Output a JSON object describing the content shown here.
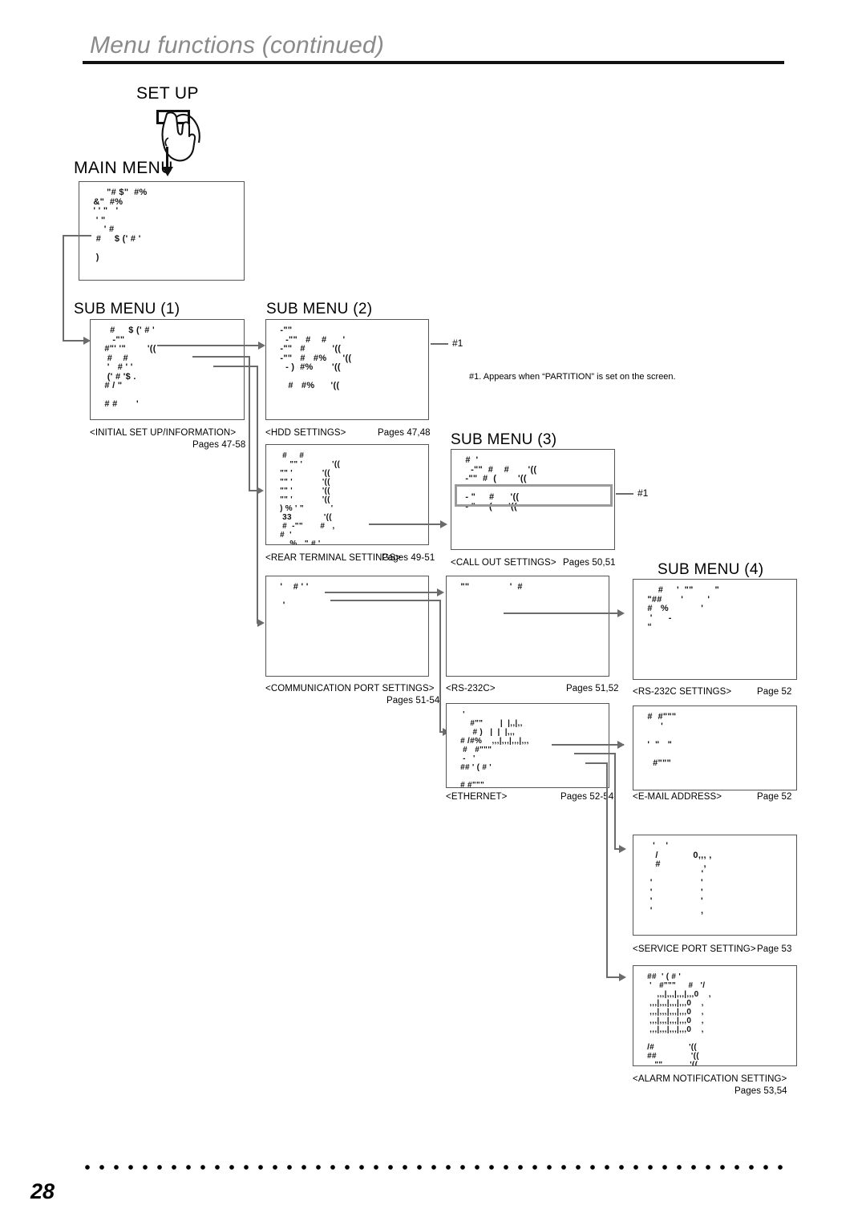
{
  "header": {
    "title": "Menu functions (continued)"
  },
  "setup": {
    "button_label": "SET UP",
    "main_menu_label": "MAIN MENU"
  },
  "sub_menu_headings": {
    "s1": "SUB MENU  (1)",
    "s2": "SUB MENU  (2)",
    "s3": "SUB MENU  (3)",
    "s4": "SUB MENU  (4)"
  },
  "footnote": {
    "marker_1": "#1",
    "marker_2": "#1",
    "text": "#1. Appears when “PARTITION” is set on the screen."
  },
  "boxes": [
    {
      "id": "main-menu",
      "caption": "",
      "pages": "",
      "screen": "      \"# $\"  #%\n &\"  #%\n ' ' \"   '\n  ' \"\n     ' #\n  #     $ (' # '\n\n  )\n\n\n  “"
    },
    {
      "id": "initial-setup-information",
      "caption": "<INITIAL SET UP/INFORMATION>",
      "pages": "Pages 47-58",
      "screen": "   #     $ (' # '\n    -\"\"\n #\"' '\"        '((\n  #    #\n  '   # ' '\n  (' # '$ .\n # / \"\n\n # #       '"
    },
    {
      "id": "hdd-settings",
      "caption": "<HDD SETTINGS>",
      "pages": "Pages 47,48",
      "screen": " -\"\"\n   -\"\"   #    #      '\n -\"\"   #          '((\n -\"\"   #   #%      '((\n   - )  #%       '((\n\n    #   #%      '(("
    },
    {
      "id": "rear-terminal-settings",
      "caption": "<REAR TERMINAL SETTINGS>",
      "pages": "Pages 49-51",
      "screen": "  #     #\n     \"\" '            '((\n \"\" '            '((\n \"\" '            '((\n \"\" '            '((\n \"\" '            '((\n ) % ' \"           '\n  33             '((\n  #  -\"\"       #   ,\n #  '\n     %   \" # '   ,"
    },
    {
      "id": "call-out-settings",
      "caption": "<CALL OUT SETTINGS>",
      "pages": "Pages 50,51",
      "screen": " #  '\n   -\"\"  #    #       '((\n -\"\"  #  (        '((\n\n - \"     #      '((\n - \"     (      '(("
    },
    {
      "id": "communication-port-settings",
      "caption": "<COMMUNICATION PORT SETTINGS>",
      "pages": "Pages 51-54",
      "screen": " '    # ' '\n\n  '"
    },
    {
      "id": "rs-232c",
      "caption": "<RS-232C>",
      "pages": "Pages 51,52",
      "screen": " \"\"               '  #"
    },
    {
      "id": "rs-232c-settings",
      "caption": "<RS-232C SETTINGS>",
      "pages": "Page 52",
      "screen": "     #     '  \"\"        \"\n \"##       '         '\n #   %            '\n  '      -\n “"
    },
    {
      "id": "ethernet",
      "caption": "<ETHERNET>",
      "pages": "Pages 52-54",
      "screen": "  '\n     #\"\"       |  |,,|,,\n      # )   |  |  |,,,\n # /#%    ,,,|,,,|,,,|,,,\n  #   #\"\"\"\n  -   '\n ## ' ( # '\n\n # #\"\"\"\n      ,  \" ,    ( ((\n   #              '\n '#  %  /"
    },
    {
      "id": "e-mail-address",
      "caption": "<E-MAIL ADDRESS>",
      "pages": "Page 52",
      "screen": " #  #\"\"\"\n      '\n\n '  \"   \"\n\n   #\"\"\""
    },
    {
      "id": "service-port-setting",
      "caption": "<SERVICE PORT SETTING>",
      "pages": "Page 53",
      "screen": "   '    '\n    /             0,,, ,\n    #                ,\n                     '\n  '                  '\n  '                  '\n  '                  '\n  '                  ,"
    },
    {
      "id": "alarm-notification-setting",
      "caption": "<ALARM NOTIFICATION SETTING>",
      "pages": "Pages 53,54",
      "screen": " ##  ' ( # '\n  '   #\"\"\"     #   '/\n     ,,,|,,,|,,,|,,,0    ,\n  ,,,|,,,|,,,|,,,0    ,\n  ,,,|,,,|,,,|,,,0    ,\n  ,,,|,,,|,,,|,,,0    ,\n  ,,,|,,,|,,,|,,,0    ,\n\n /#              '((\n ##              '((\n    \"\"           '((\n   %              ,"
    }
  ],
  "footer": {
    "page_number": "28"
  }
}
